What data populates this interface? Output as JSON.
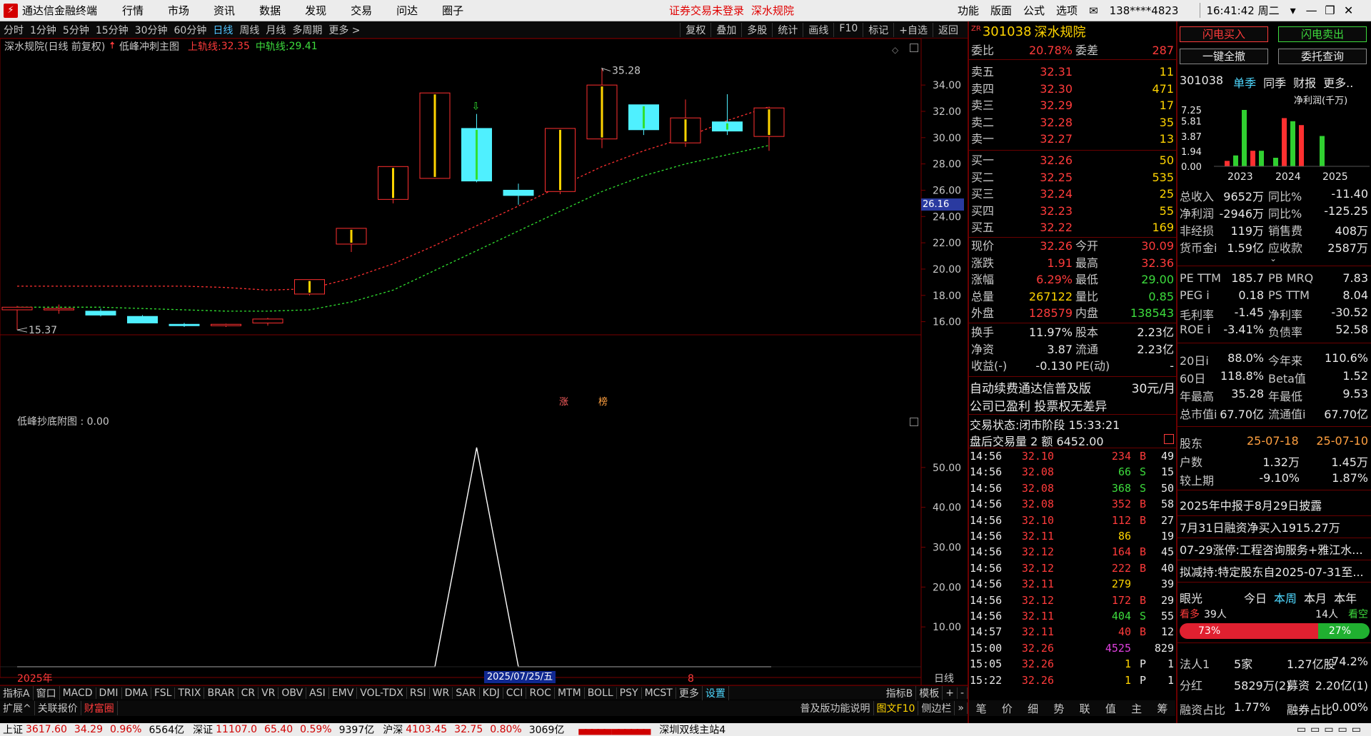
{
  "titlebar": {
    "app_title": "通达信金融终端",
    "menu": [
      "行情",
      "市场",
      "资讯",
      "数据",
      "发现",
      "交易",
      "问达",
      "圈子"
    ],
    "notice": "证券交易未登录",
    "stock": "深水规院",
    "tools": [
      "功能",
      "版面",
      "公式",
      "选项"
    ],
    "user": "138****4823",
    "time": "16:41:42 周二"
  },
  "toolbar": {
    "periods": [
      "分时",
      "1分钟",
      "5分钟",
      "15分钟",
      "30分钟",
      "60分钟",
      "日线",
      "周线",
      "月线",
      "多周期",
      "更多 >"
    ],
    "active": "日线",
    "tools": [
      "复权",
      "叠加",
      "多股",
      "统计",
      "画线",
      "F10",
      "标记",
      "+自选",
      "返回"
    ]
  },
  "chart": {
    "stock_label": "深水规院(日线 前复权)",
    "indicator": "低峰冲刺主图",
    "upper_label": "上轨线:",
    "upper_value": "32.35",
    "mid_label": "中轨线:",
    "mid_value": "29.41",
    "peak_label": "35.28",
    "low_label": "15.37",
    "price_marker": "26.16",
    "marks": [
      "涨",
      "榜"
    ],
    "sub_title": "低峰抄底附图 : 0.00",
    "year_label": "2025年",
    "cursor_date": "2025/07/25/五",
    "cursor_mark": "8",
    "period_label": "日线",
    "price_ticks": [
      "34.00",
      "32.00",
      "30.00",
      "28.00",
      "26.00",
      "24.00",
      "22.00",
      "20.00",
      "18.00",
      "16.00"
    ],
    "sub_ticks": [
      "50.00",
      "40.00",
      "30.00",
      "20.00",
      "10.00"
    ]
  },
  "chart_data": {
    "type": "candlestick",
    "candles": [
      {
        "o": 16.9,
        "h": 17.2,
        "l": 15.37,
        "c": 17.1
      },
      {
        "o": 17.0,
        "h": 17.3,
        "l": 16.6,
        "c": 17.0
      },
      {
        "o": 16.8,
        "h": 17.0,
        "l": 16.4,
        "c": 16.5
      },
      {
        "o": 16.4,
        "h": 16.5,
        "l": 15.9,
        "c": 15.9
      },
      {
        "o": 15.8,
        "h": 15.9,
        "l": 15.6,
        "c": 15.7
      },
      {
        "o": 15.75,
        "h": 15.85,
        "l": 15.6,
        "c": 15.8
      },
      {
        "o": 15.9,
        "h": 16.3,
        "l": 15.7,
        "c": 16.2
      },
      {
        "o": 18.1,
        "h": 19.2,
        "l": 18.0,
        "c": 19.2
      },
      {
        "o": 21.9,
        "h": 23.1,
        "l": 21.3,
        "c": 23.1
      },
      {
        "o": 25.3,
        "h": 27.8,
        "l": 25.0,
        "c": 27.8
      },
      {
        "o": 26.9,
        "h": 33.4,
        "l": 26.9,
        "c": 33.4
      },
      {
        "o": 30.7,
        "h": 31.8,
        "l": 26.6,
        "c": 26.7
      },
      {
        "o": 26.0,
        "h": 26.5,
        "l": 24.9,
        "c": 25.6
      },
      {
        "o": 25.9,
        "h": 30.7,
        "l": 25.7,
        "c": 30.7
      },
      {
        "o": 29.9,
        "h": 35.28,
        "l": 29.2,
        "c": 34.0
      },
      {
        "o": 32.5,
        "h": 32.5,
        "l": 30.2,
        "c": 30.6
      },
      {
        "o": 29.6,
        "h": 32.9,
        "l": 29.3,
        "c": 31.5
      },
      {
        "o": 31.2,
        "h": 33.3,
        "l": 30.2,
        "c": 30.5
      },
      {
        "o": 30.09,
        "h": 32.36,
        "l": 29.0,
        "c": 32.26
      }
    ],
    "upper": [
      18.7,
      18.7,
      18.7,
      18.7,
      18.7,
      18.6,
      18.4,
      18.5,
      19.3,
      20.4,
      21.8,
      23.3,
      24.8,
      26.3,
      27.8,
      29.0,
      30.0,
      31.3,
      32.35
    ],
    "mid": [
      17.1,
      17.1,
      17.1,
      17.0,
      16.9,
      16.8,
      16.8,
      16.9,
      17.5,
      18.4,
      19.9,
      21.4,
      22.9,
      24.4,
      25.9,
      27.1,
      28.0,
      28.7,
      29.41
    ],
    "sub": [
      0,
      0,
      0,
      0,
      0,
      0,
      0,
      0,
      0,
      0,
      0,
      55,
      0,
      0,
      0,
      0,
      0,
      0,
      0
    ],
    "ylim": [
      15,
      35.8
    ],
    "sub_ylim": [
      0,
      60
    ]
  },
  "quote": {
    "code": "301038",
    "name": "深水规院",
    "wb_label": "委比",
    "wb": "20.78%",
    "wc_label": "委差",
    "wc": "287",
    "asks": [
      {
        "n": "卖五",
        "p": "32.31",
        "v": "11"
      },
      {
        "n": "卖四",
        "p": "32.30",
        "v": "471"
      },
      {
        "n": "卖三",
        "p": "32.29",
        "v": "17"
      },
      {
        "n": "卖二",
        "p": "32.28",
        "v": "35"
      },
      {
        "n": "卖一",
        "p": "32.27",
        "v": "13"
      }
    ],
    "bids": [
      {
        "n": "买一",
        "p": "32.26",
        "v": "50"
      },
      {
        "n": "买二",
        "p": "32.25",
        "v": "535"
      },
      {
        "n": "买三",
        "p": "32.24",
        "v": "25"
      },
      {
        "n": "买四",
        "p": "32.23",
        "v": "55"
      },
      {
        "n": "买五",
        "p": "32.22",
        "v": "169"
      }
    ],
    "stats": [
      [
        "现价",
        "32.26",
        "今开",
        "30.09"
      ],
      [
        "涨跌",
        "1.91",
        "最高",
        "32.36"
      ],
      [
        "涨幅",
        "6.29%",
        "最低",
        "29.00"
      ],
      [
        "总量",
        "267122",
        "量比",
        "0.85"
      ],
      [
        "外盘",
        "128579",
        "内盘",
        "138543"
      ]
    ],
    "stats2": [
      [
        "换手",
        "11.97%",
        "股本",
        "2.23亿"
      ],
      [
        "净资",
        "3.87",
        "流通",
        "2.23亿"
      ],
      [
        "收益(-)",
        "-0.130",
        "PE(动)",
        "-"
      ]
    ],
    "ad1": "自动续费通达信普及版",
    "ad1_price": "30元/月",
    "ad2": "公司已盈利 投票权无差异",
    "trade_state": "交易状态:闭市阶段 15:33:21",
    "after": "盘后交易量 2 额 6452.00",
    "ticks": [
      [
        "14:56",
        "32.10",
        "234",
        "B",
        "49"
      ],
      [
        "14:56",
        "32.08",
        "66",
        "S",
        "15"
      ],
      [
        "14:56",
        "32.08",
        "368",
        "S",
        "50"
      ],
      [
        "14:56",
        "32.08",
        "352",
        "B",
        "58"
      ],
      [
        "14:56",
        "32.10",
        "112",
        "B",
        "27"
      ],
      [
        "14:56",
        "32.11",
        "86",
        "",
        "19"
      ],
      [
        "14:56",
        "32.12",
        "164",
        "B",
        "45"
      ],
      [
        "14:56",
        "32.12",
        "222",
        "B",
        "40"
      ],
      [
        "14:56",
        "32.11",
        "279",
        "",
        "39"
      ],
      [
        "14:56",
        "32.12",
        "172",
        "B",
        "29"
      ],
      [
        "14:56",
        "32.11",
        "404",
        "S",
        "55"
      ],
      [
        "14:57",
        "32.11",
        "40",
        "B",
        "12"
      ],
      [
        "15:00",
        "32.26",
        "4525",
        "",
        "829"
      ],
      [
        "15:05",
        "32.26",
        "1",
        "P",
        "1"
      ],
      [
        "15:22",
        "32.26",
        "1",
        "P",
        "1"
      ]
    ]
  },
  "fin": {
    "btn_buy": "闪电买入",
    "btn_sell": "闪电卖出",
    "btn_cancel": "一键全撤",
    "btn_query": "委托查询",
    "code": "301038",
    "tabs": [
      "单季",
      "同季",
      "财报",
      "更多.."
    ],
    "metric": "净利润(千万)",
    "yticks": [
      "7.25",
      "5.81",
      "3.87",
      "1.94",
      "0.00"
    ],
    "years": [
      "2023",
      "2024",
      "2025"
    ],
    "rows": [
      [
        "总收入",
        "9652万",
        "同比%",
        "-11.40"
      ],
      [
        "净利润",
        "-2946万",
        "同比%",
        "-125.25"
      ],
      [
        "非经损",
        "119万",
        "销售费",
        "408万"
      ],
      [
        "货币金i",
        "1.59亿",
        "应收款",
        "2587万"
      ]
    ],
    "rows2": [
      [
        "PE TTM",
        "185.7",
        "PB MRQ",
        "7.83"
      ],
      [
        "PEG i",
        "0.18",
        "PS TTM",
        "8.04"
      ],
      [
        "毛利率",
        "-1.45",
        "净利率",
        "-30.52"
      ],
      [
        "ROE i",
        "-3.41%",
        "负债率",
        "52.58"
      ]
    ],
    "rows3": [
      [
        "20日i",
        "88.0%",
        "今年来",
        "110.6%"
      ],
      [
        "60日",
        "118.8%",
        "Beta值",
        "1.52"
      ],
      [
        "年最高",
        "35.28",
        "年最低",
        "9.53"
      ],
      [
        "总市值i",
        "67.70亿",
        "流通值i",
        "67.70亿"
      ]
    ],
    "holders": {
      "label": "股东",
      "d1": "25-07-18",
      "d2": "25-07-10",
      "r1": [
        "户数",
        "1.32万",
        "1.45万"
      ],
      "r2": [
        "较上期",
        "-9.10%",
        "1.87%"
      ]
    },
    "news": [
      "2025年中报于8月29日披露",
      "7月31日融资净买入1915.27万",
      "07-29涨停:工程咨询服务+雅江水...",
      "拟减持:特定股东自2025-07-31至..."
    ],
    "eye": {
      "label": "眼光",
      "tabs": [
        "今日",
        "本周",
        "本月",
        "本年"
      ],
      "bull_label": "看多",
      "bull": "39人",
      "bear": "14人",
      "bear_label": "看空",
      "bull_pct": "73%",
      "bear_pct": "27%"
    },
    "inst": [
      "法人1",
      "5家",
      "1.27亿股",
      "74.2%"
    ],
    "div": [
      "分红",
      "5829万(2)",
      "募资",
      "2.20亿(1)"
    ],
    "margin": [
      "融资占比",
      "1.77%",
      "融券占比",
      "0.00%"
    ],
    "bars": [
      {
        "g": [
          0.7,
          1.4,
          2.0,
          7.25,
          2.0
        ],
        "r": [
          0.8,
          1.3
        ]
      },
      {
        "g": [
          1.1,
          5.8,
          5.3,
          1.0
        ],
        "r": [
          6.2,
          5.8
        ]
      },
      {
        "g": [
          3.9,
          0.6
        ],
        "r": []
      }
    ]
  },
  "indicators": [
    "指标A",
    "窗口",
    "MACD",
    "DMI",
    "DMA",
    "FSL",
    "TRIX",
    "BRAR",
    "CR",
    "VR",
    "OBV",
    "ASI",
    "EMV",
    "VOL-TDX",
    "RSI",
    "WR",
    "SAR",
    "KDJ",
    "CCI",
    "ROC",
    "MTM",
    "BOLL",
    "PSY",
    "MCST",
    "更多",
    "设置"
  ],
  "ind_right": [
    "指标B",
    "模板",
    "+",
    "-"
  ],
  "bottom_tabs": [
    "扩展^",
    "关联报价",
    "财富圈"
  ],
  "bottom_mid": [
    "普及版功能说明",
    "图文F10",
    "侧边栏"
  ],
  "right_tabs": [
    "笔",
    "价",
    "细",
    "势",
    "联",
    "值",
    "主",
    "筹"
  ],
  "status": {
    "sh_label": "上证",
    "sh": "3617.60",
    "sh_chg": "34.29",
    "sh_pct": "0.96%",
    "sh_amt": "6564亿",
    "sz_label": "深证",
    "sz": "11107.0",
    "sz_chg": "65.40",
    "sz_pct": "0.59%",
    "sz_amt": "9397亿",
    "hs_label": "沪深",
    "hs": "4103.45",
    "hs_chg": "32.75",
    "hs_pct": "0.80%",
    "hs_amt": "3069亿",
    "server": "深圳双线主站4"
  }
}
